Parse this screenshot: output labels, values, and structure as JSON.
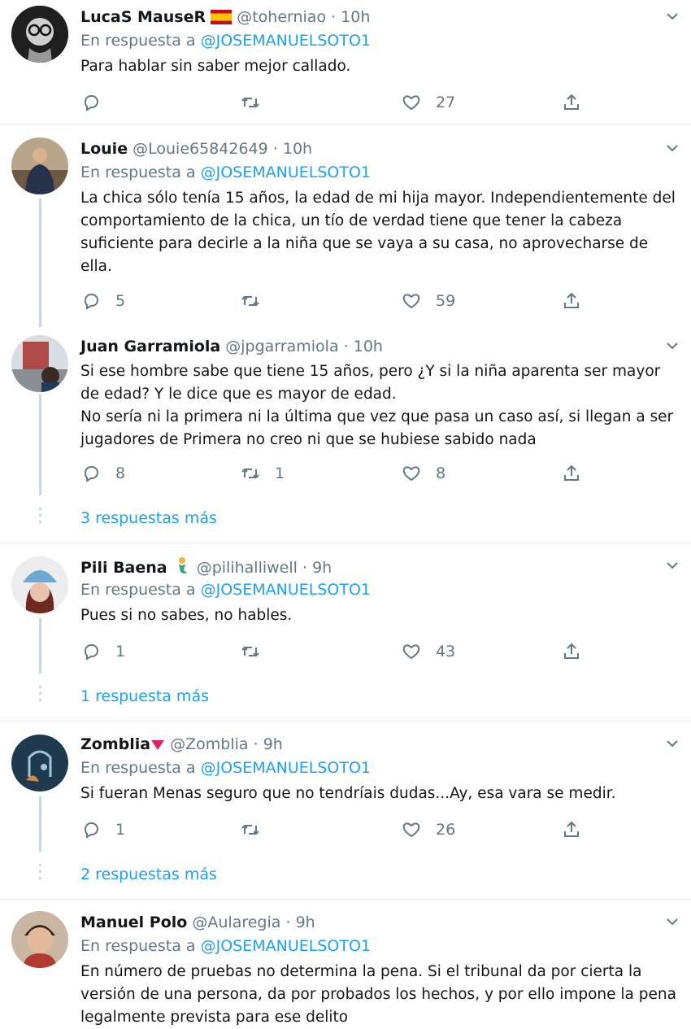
{
  "reply_prefix": "En respuesta a",
  "tweets": [
    {
      "name": "LucaS MauseR",
      "handle": "@toherniao",
      "time": "10h",
      "reply_to": "@JOSEMANUELSOTO1",
      "text": [
        "Para hablar sin saber mejor callado."
      ],
      "replies": "",
      "retweets": "",
      "likes": "27",
      "badge": "spain-flag"
    },
    {
      "name": "Louie",
      "handle": "@Louie65842649",
      "time": "10h",
      "reply_to": "@JOSEMANUELSOTO1",
      "text": [
        "La chica sólo tenía 15 años, la edad de mi hija mayor. Independientemente del comportamiento de la chica, un tío de verdad tiene que tener la cabeza suficiente para decirle a la niña que se vaya a su casa, no aprovecharse de ella."
      ],
      "replies": "5",
      "retweets": "",
      "likes": "59"
    },
    {
      "name": "Juan Garramiola",
      "handle": "@jpgarramiola",
      "time": "10h",
      "reply_to": "",
      "text": [
        "Si ese hombre sabe que tiene 15 años, pero ¿Y si la niña aparenta ser mayor de edad? Y le dice que es mayor de edad.",
        "No sería ni la primera ni la última que vez que pasa un caso así, si llegan a ser jugadores de Primera no creo ni que se hubiese sabido nada"
      ],
      "replies": "8",
      "retweets": "1",
      "likes": "8",
      "more": "3 respuestas más"
    },
    {
      "name": "Pili Baena",
      "handle": "@pilihalliwell",
      "time": "9h",
      "reply_to": "@JOSEMANUELSOTO1",
      "text": [
        "Pues si no sabes, no hables."
      ],
      "replies": "1",
      "retweets": "",
      "likes": "43",
      "more": "1 respuesta más",
      "badge": "mermaid-emoji"
    },
    {
      "name": "Zomblia",
      "handle": "@Zomblia",
      "time": "9h",
      "reply_to": "@JOSEMANUELSOTO1",
      "text": [
        "Si fueran Menas seguro que no tendríais dudas...Ay, esa vara se medir."
      ],
      "replies": "1",
      "retweets": "",
      "likes": "26",
      "more": "2 respuestas más",
      "badge": "red-triangle"
    },
    {
      "name": "Manuel Polo",
      "handle": "@Aularegia",
      "time": "9h",
      "reply_to": "@JOSEMANUELSOTO1",
      "text": [
        "En número de pruebas no determina la pena. Si el tribunal da por cierta la versión de una persona, da por probados los hechos, y por ello impone la pena legalmente prevista para ese delito"
      ],
      "replies": "",
      "retweets": "",
      "likes": ""
    }
  ],
  "dot": "·",
  "colors": {
    "link": "#1da1f2",
    "muted": "#657786",
    "thread": "#ccd6dd",
    "divider": "#e6ecf0"
  }
}
